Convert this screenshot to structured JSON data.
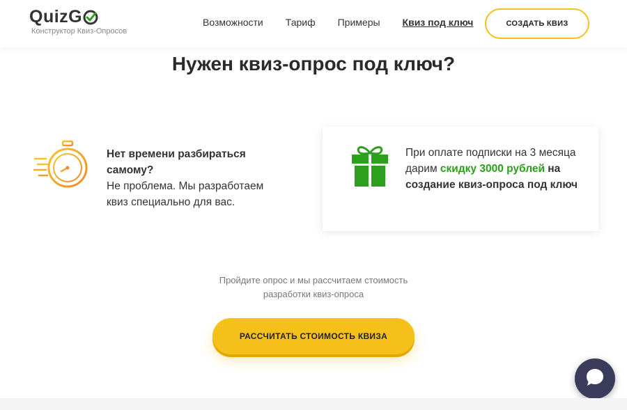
{
  "header": {
    "logo_text": "QuizG",
    "logo_subtitle": "Конструктор Квиз-Опросов",
    "nav": [
      {
        "label": "Возможности"
      },
      {
        "label": "Тариф"
      },
      {
        "label": "Примеры"
      },
      {
        "label": "Квиз под ключ"
      }
    ],
    "create_button": "СОЗДАТЬ КВИЗ"
  },
  "main": {
    "title": "Нужен квиз-опрос под ключ?",
    "left_feature": {
      "bold": "Нет времени разбираться самому?",
      "text": "Не проблема. Мы разработаем квиз специально для вас."
    },
    "offer_card": {
      "text_before": "При оплате подписки на 3 месяца дарим ",
      "highlight": "скидку 3000 рублей",
      "text_after": " на создание квиз-опроса под ключ"
    },
    "calc_note_line1": "Пройдите опрос и мы рассчитаем стоимость",
    "calc_note_line2": "разработки квиз-опроса",
    "calc_button": "РАССЧИТАТЬ СТОИМОСТЬ КВИЗА"
  },
  "icons": {
    "stopwatch": "stopwatch-icon",
    "gift": "gift-icon",
    "chat": "chat-icon",
    "logo_check": "check-circle-icon"
  },
  "colors": {
    "accent_yellow": "#f5c01a",
    "green": "#2ca01c",
    "chat_bg": "#3b3b5c"
  }
}
